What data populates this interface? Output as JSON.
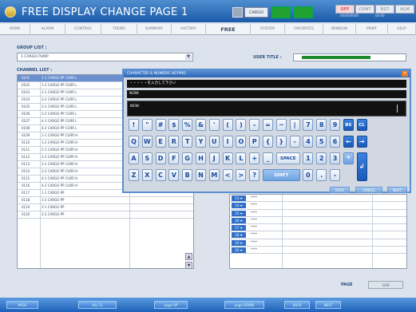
{
  "header": {
    "title": "FREE DISPLAY CHANGE PAGE",
    "page_number": "1",
    "cargo_label": "CARGO",
    "status": [
      {
        "label": "OFF",
        "color": "#e05050",
        "bg": "#f4d8dc"
      },
      {
        "label": "CONT",
        "color": "#a0a8b4",
        "bg": "#e8ecf2"
      },
      {
        "label": "RST",
        "color": "#a0a8b4",
        "bg": "#e8ecf2"
      },
      {
        "label": "ALM",
        "color": "#a0a8b4",
        "bg": "#e8ecf2"
      }
    ],
    "date": "00/00/0000",
    "time": "00:00"
  },
  "menu": {
    "items": [
      "HOME",
      "ALARM",
      "CONTROL",
      "TREND",
      "SUMMARY",
      "HISTORY",
      "FREE",
      "SYSTEM",
      "FAVORITES",
      "WINDOW",
      "PRINT",
      "HELP"
    ]
  },
  "group": {
    "label": "GROUP LIST :",
    "selected": "1 CARGO PUMP"
  },
  "user_title": {
    "label": "USER TITLE :",
    "value": "CCCCCCCCCCCCCCCCCCCCC"
  },
  "channel": {
    "label": "CHANNEL LIST :",
    "rows": [
      {
        "id": "0101",
        "name": "1-1 CARGO PP CURR L"
      },
      {
        "id": "0102",
        "name": "1-2 CARGO PP CURR L"
      },
      {
        "id": "0103",
        "name": "2-1 CARGO PP CURR L"
      },
      {
        "id": "0104",
        "name": "2-2 CARGO PP CURR L"
      },
      {
        "id": "0105",
        "name": "3-1 CARGO PP CURR L"
      },
      {
        "id": "0106",
        "name": "3-2 CARGO PP CURR L"
      },
      {
        "id": "0107",
        "name": "4-1 CARGO PP CURR L"
      },
      {
        "id": "0108",
        "name": "4-2 CARGO PP CURR L"
      },
      {
        "id": "0109",
        "name": "1-1 CARGO PP CURR H"
      },
      {
        "id": "0110",
        "name": "1-2 CARGO PP CURR H"
      },
      {
        "id": "0111",
        "name": "2-1 CARGO PP CURR H"
      },
      {
        "id": "0112",
        "name": "2-2 CARGO PP CURR H"
      },
      {
        "id": "0113",
        "name": "3-1 CARGO PP CURR H"
      },
      {
        "id": "0114",
        "name": "3-2 CARGO PP CURR H"
      },
      {
        "id": "0115",
        "name": "4-1 CARGO PP CURR H"
      },
      {
        "id": "0116",
        "name": "4-2 CARGO PP CURR H"
      },
      {
        "id": "0117",
        "name": "1-1 CARGO PP"
      },
      {
        "id": "0118",
        "name": "1-2 CARGO PP"
      },
      {
        "id": "0119",
        "name": "2-1 CARGO PP"
      },
      {
        "id": "0120",
        "name": "2-2 CARGO PP"
      }
    ]
  },
  "slots": [
    {
      "num": "13",
      "value": "****"
    },
    {
      "num": "14",
      "value": "****"
    },
    {
      "num": "15",
      "value": "****"
    },
    {
      "num": "16",
      "value": "****"
    },
    {
      "num": "17",
      "value": "****"
    },
    {
      "num": "18",
      "value": "****"
    },
    {
      "num": "19",
      "value": "****"
    },
    {
      "num": "20",
      "value": "****"
    }
  ],
  "page": {
    "label": "PAGE",
    "value": "1/10"
  },
  "footer": {
    "buttons": [
      "PAGE",
      "ALL CL",
      "page UP",
      "page DOWN",
      "BACK",
      "NEXT"
    ]
  },
  "keypad": {
    "title": "CHARACTER & NUMERIC KEYPAD",
    "prompt": "・・・・・を入力して下さい",
    "now_label": "NOW:",
    "new_label": "NEW:",
    "rows": [
      [
        "!",
        "\"",
        "#",
        "$",
        "%",
        "&",
        "'",
        "(",
        ")",
        "-",
        "=",
        "~",
        "|",
        "7",
        "8",
        "9",
        "BS",
        "CL"
      ],
      [
        "Q",
        "W",
        "E",
        "R",
        "T",
        "Y",
        "U",
        "I",
        "O",
        "P",
        "{",
        "}",
        "-",
        "4",
        "5",
        "6",
        "←",
        "→"
      ],
      [
        "A",
        "S",
        "D",
        "F",
        "G",
        "H",
        "J",
        "K",
        "L",
        "+",
        "_",
        "SPACE",
        "1",
        "2",
        "3",
        "*",
        "↲"
      ],
      [
        "Z",
        "X",
        "C",
        "V",
        "B",
        "N",
        "M",
        "<",
        ">",
        "?",
        "SHIFT",
        "0",
        ".",
        "-"
      ]
    ],
    "bottom_buttons": [
      "BACK",
      "CANCEL",
      "NEXT"
    ]
  }
}
